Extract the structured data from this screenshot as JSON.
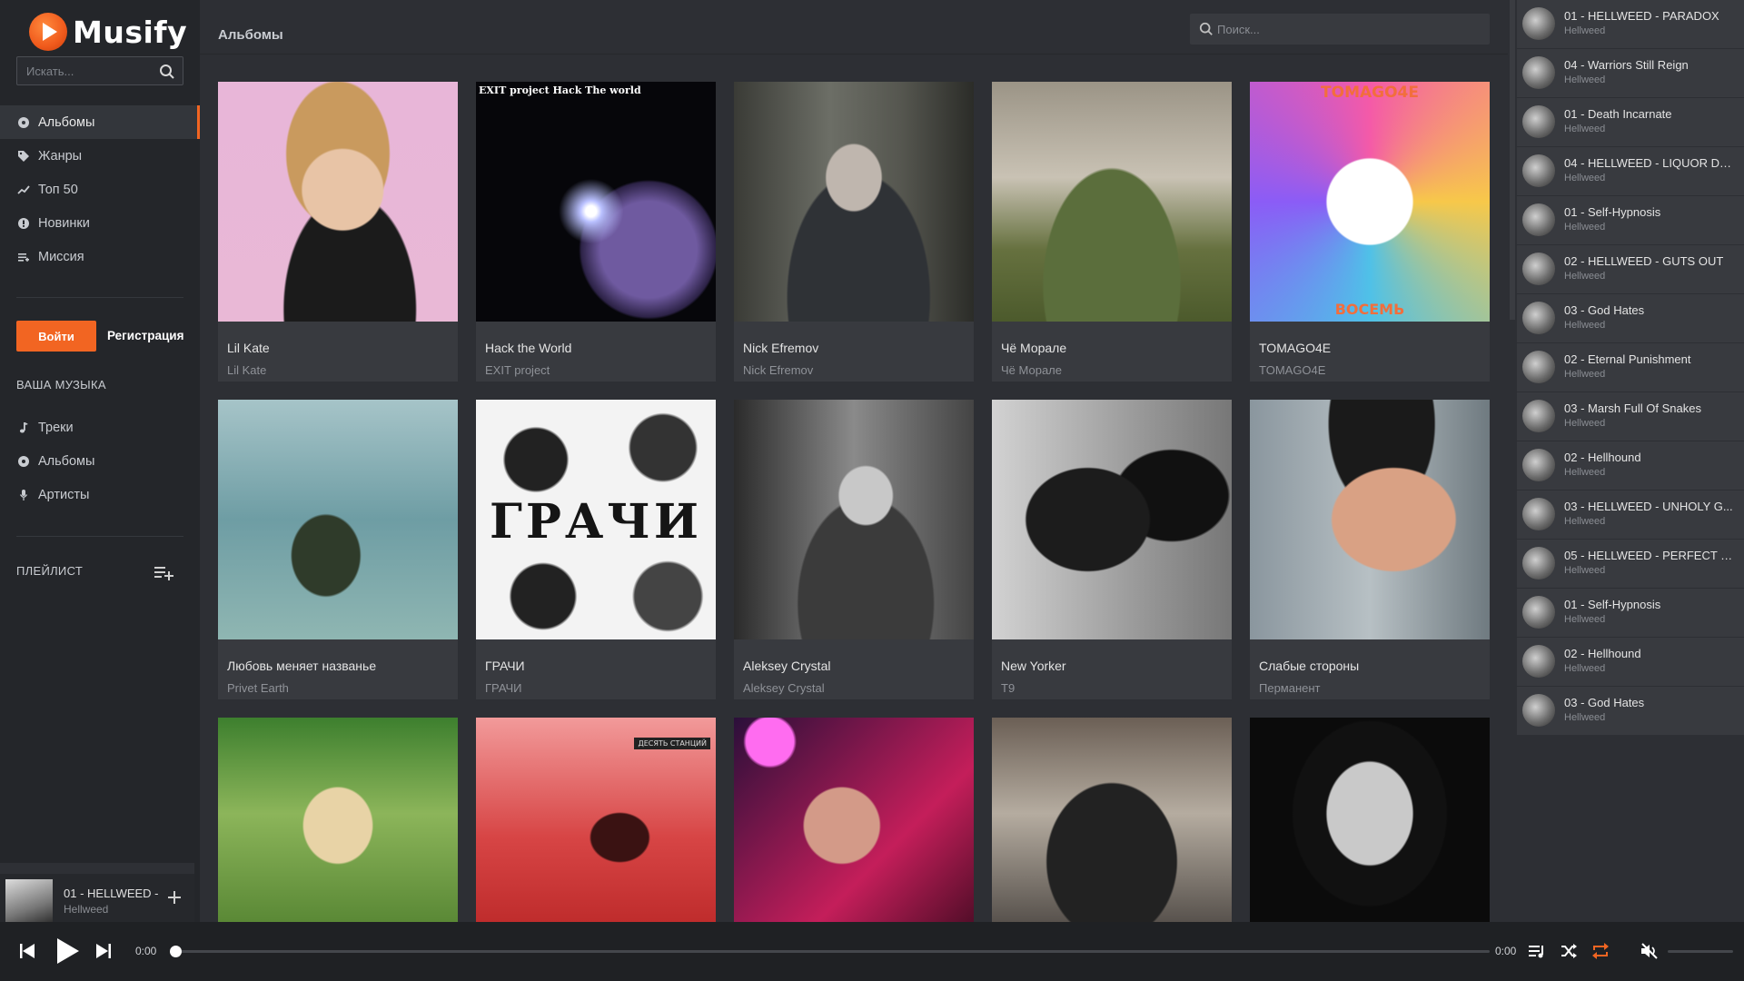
{
  "app": {
    "name": "Musify",
    "accent": "#f26522"
  },
  "sidebar": {
    "search_placeholder": "Искать...",
    "nav": [
      {
        "label": "Альбомы",
        "icon": "disc-icon",
        "active": true
      },
      {
        "label": "Жанры",
        "icon": "tag-icon"
      },
      {
        "label": "Топ 50",
        "icon": "trending-icon"
      },
      {
        "label": "Новинки",
        "icon": "badge-icon"
      },
      {
        "label": "Миссия",
        "icon": "list-icon"
      }
    ],
    "login_label": "Войти",
    "register_label": "Регистрация",
    "your_music_title": "ВАША МУЗЫКА",
    "your_music": [
      {
        "label": "Треки",
        "icon": "music-note-icon"
      },
      {
        "label": "Альбомы",
        "icon": "disc-icon"
      },
      {
        "label": "Артисты",
        "icon": "microphone-icon"
      }
    ],
    "playlist_title": "ПЛЕЙЛИСТ",
    "now_playing": {
      "title": "01 - HELLWEED -",
      "artist": "Hellweed"
    }
  },
  "main": {
    "title": "Альбомы",
    "search_placeholder": "Поиск...",
    "albums": [
      {
        "title": "Lil Kate",
        "artist": "Lil Kate"
      },
      {
        "title": "Hack the World",
        "artist": "EXIT project",
        "cover_text": "EXIT project Hack The world"
      },
      {
        "title": "Nick Efremov",
        "artist": "Nick Efremov"
      },
      {
        "title": "Чё Моралe",
        "artist": "Чё Моралe"
      },
      {
        "title": "TOMAGO4E",
        "artist": "TOMAGO4E",
        "cover_top": "TOMAGO4E",
        "cover_bottom": "ВОСЕМЬ"
      },
      {
        "title": "Любовь меняет названье",
        "artist": "Privet Earth"
      },
      {
        "title": "ГРАЧИ",
        "artist": "ГРАЧИ",
        "cover_big": "ГРАЧИ"
      },
      {
        "title": "Aleksey Crystal",
        "artist": "Aleksey Crystal"
      },
      {
        "title": "New Yorker",
        "artist": "T9"
      },
      {
        "title": "Слабые стороны",
        "artist": "Перманент"
      },
      {
        "title": "",
        "artist": ""
      },
      {
        "title": "",
        "artist": "",
        "cover_tag": "ДЕСЯТЬ СТАНЦИЙ"
      },
      {
        "title": "",
        "artist": ""
      },
      {
        "title": "",
        "artist": ""
      },
      {
        "title": "",
        "artist": ""
      }
    ]
  },
  "queue": [
    {
      "title": "01 - HELLWEED - PARADOX",
      "artist": "Hellweed"
    },
    {
      "title": "04 - Warriors Still Reign",
      "artist": "Hellweed"
    },
    {
      "title": "01 - Death Incarnate",
      "artist": "Hellweed"
    },
    {
      "title": "04 - HELLWEED - LIQUOR DR...",
      "artist": "Hellweed"
    },
    {
      "title": "01 - Self-Hypnosis",
      "artist": "Hellweed"
    },
    {
      "title": "02 - HELLWEED - GUTS OUT",
      "artist": "Hellweed"
    },
    {
      "title": "03 - God Hates",
      "artist": "Hellweed"
    },
    {
      "title": "02 - Eternal Punishment",
      "artist": "Hellweed"
    },
    {
      "title": "03 - Marsh Full Of Snakes",
      "artist": "Hellweed"
    },
    {
      "title": "02 - Hellhound",
      "artist": "Hellweed"
    },
    {
      "title": "03 - HELLWEED - UNHOLY G...",
      "artist": "Hellweed"
    },
    {
      "title": "05 - HELLWEED - PERFECT E...",
      "artist": "Hellweed"
    },
    {
      "title": "01 - Self-Hypnosis",
      "artist": "Hellweed"
    },
    {
      "title": "02 - Hellhound",
      "artist": "Hellweed"
    },
    {
      "title": "03 - God Hates",
      "artist": "Hellweed"
    }
  ],
  "player": {
    "current_time": "0:00",
    "duration": "0:00",
    "progress": 0,
    "repeat_active": true,
    "muted": true
  }
}
